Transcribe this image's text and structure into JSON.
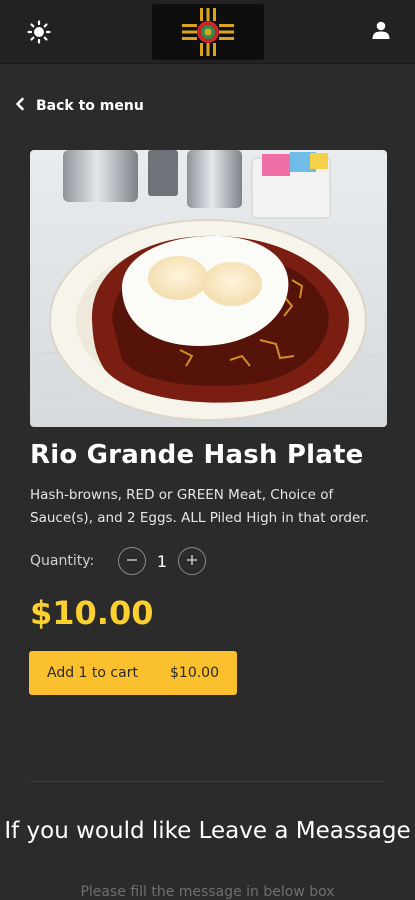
{
  "header": {
    "theme_icon": "sun-icon",
    "account_icon": "user-icon",
    "logo": "zia-sun-logo"
  },
  "nav": {
    "back_label": "Back to menu"
  },
  "product": {
    "image": "hash-plate-photo",
    "title": "Rio Grande Hash Plate",
    "description": "Hash-browns, RED or GREEN Meat, Choice of Sauce(s), and 2 Eggs. ALL Piled High in that order.",
    "quantity_label": "Quantity:",
    "quantity": "1",
    "price": "$10.00"
  },
  "cart_button": {
    "label": "Add 1 to cart",
    "price": "$10.00"
  },
  "message_section": {
    "title": "If you would like Leave a Meassage",
    "subtitle": "Please fill the message in below box"
  },
  "colors": {
    "background": "#2b2b2b",
    "topbar": "#222222",
    "accent": "#fbc02d",
    "price": "#fcd02f"
  }
}
